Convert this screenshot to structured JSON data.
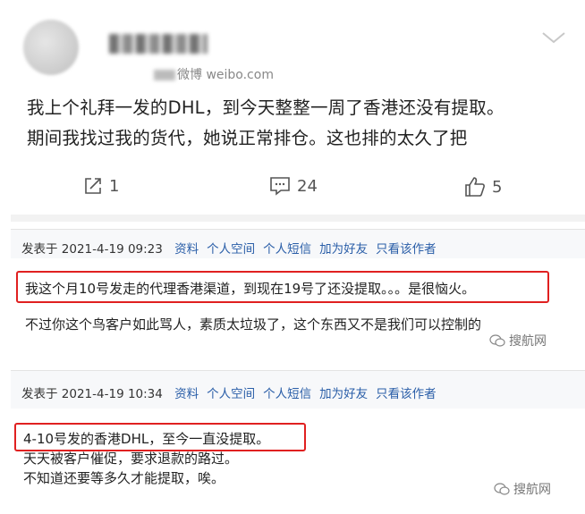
{
  "post": {
    "source_text": "微博 weibo.com",
    "lines": [
      "我上个礼拜一发的DHL，到今天整整一周了香港还没有提取。",
      "期间我找过我的货代，她说正常排仓。这也排的太久了把"
    ],
    "actions": {
      "repost_count": "1",
      "comment_count": "24",
      "like_count": "5"
    }
  },
  "replies": [
    {
      "posted_at": "发表于 2021-4-19 09:23",
      "links": [
        "资料",
        "个人空间",
        "个人短信",
        "加为好友",
        "只看该作者"
      ],
      "highlighted": "我这个月10号发走的代理香港渠道，到现在19号了还没提取。。。是很恼火。",
      "lines": [
        "不过你这个鸟客户如此骂人，素质太垃圾了，这个东西又不是我们可以控制的"
      ],
      "watermark": "搜航网"
    },
    {
      "posted_at": "发表于 2021-4-19 10:34",
      "links": [
        "资料",
        "个人空间",
        "个人短信",
        "加为好友",
        "只看该作者"
      ],
      "highlighted": "4-10号发的香港DHL，至今一直没提取。",
      "lines": [
        "天天被客户催促，要求退款的路过。",
        "不知道还要等多久才能提取，唉。"
      ],
      "watermark": "搜航网"
    }
  ],
  "colors": {
    "link": "#2a5ea8",
    "highlight_border": "#e02020",
    "panel_bg": "#f7f8fa"
  },
  "icons": [
    "chevron-down-icon",
    "repost-icon",
    "comment-icon",
    "like-icon",
    "wechat-icon"
  ]
}
